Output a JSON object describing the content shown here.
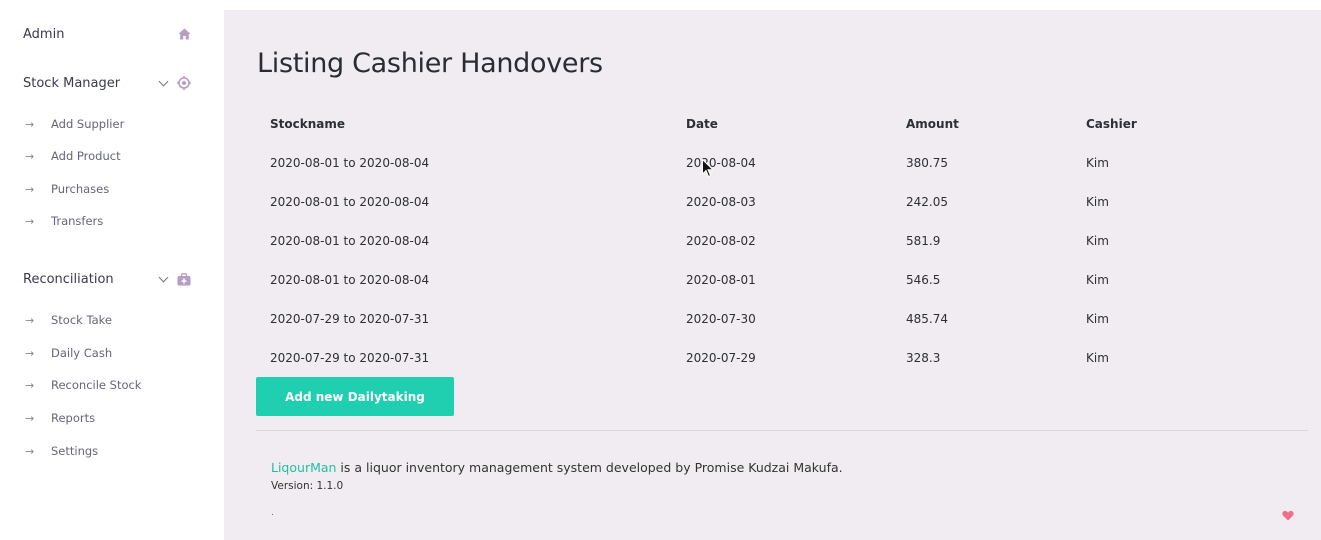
{
  "sidebar": {
    "admin": {
      "label": "Admin",
      "icon": "home-icon"
    },
    "stock_manager": {
      "label": "Stock Manager",
      "icon": "target-icon",
      "items": [
        {
          "label": "Add Supplier"
        },
        {
          "label": "Add Product"
        },
        {
          "label": "Purchases"
        },
        {
          "label": "Transfers"
        }
      ]
    },
    "reconciliation": {
      "label": "Reconciliation",
      "icon": "briefcase-icon",
      "items": [
        {
          "label": "Stock Take"
        },
        {
          "label": "Daily Cash"
        },
        {
          "label": "Reconcile Stock"
        },
        {
          "label": "Reports"
        },
        {
          "label": "Settings"
        }
      ]
    }
  },
  "main": {
    "title": "Listing Cashier Handovers",
    "table": {
      "headers": [
        "Stockname",
        "Date",
        "Amount",
        "Cashier"
      ],
      "rows": [
        [
          "2020-08-01 to 2020-08-04",
          "2020-08-04",
          "380.75",
          "Kim"
        ],
        [
          "2020-08-01 to 2020-08-04",
          "2020-08-03",
          "242.05",
          "Kim"
        ],
        [
          "2020-08-01 to 2020-08-04",
          "2020-08-02",
          "581.9",
          "Kim"
        ],
        [
          "2020-08-01 to 2020-08-04",
          "2020-08-01",
          "546.5",
          "Kim"
        ],
        [
          "2020-07-29 to 2020-07-31",
          "2020-07-30",
          "485.74",
          "Kim"
        ],
        [
          "2020-07-29 to 2020-07-31",
          "2020-07-29",
          "328.3",
          "Kim"
        ]
      ]
    },
    "add_button": "Add new Dailytaking"
  },
  "footer": {
    "brand": "LiqourMan",
    "description": " is a liquor inventory management system developed by Promise Kudzai Makufa.",
    "version": "Version: 1.1.0",
    "dot": "."
  },
  "colors": {
    "accent": "#1fcfb0",
    "main_bg": "#f1ecf1",
    "icon": "#b79cc4",
    "heart": "#f0708a"
  }
}
